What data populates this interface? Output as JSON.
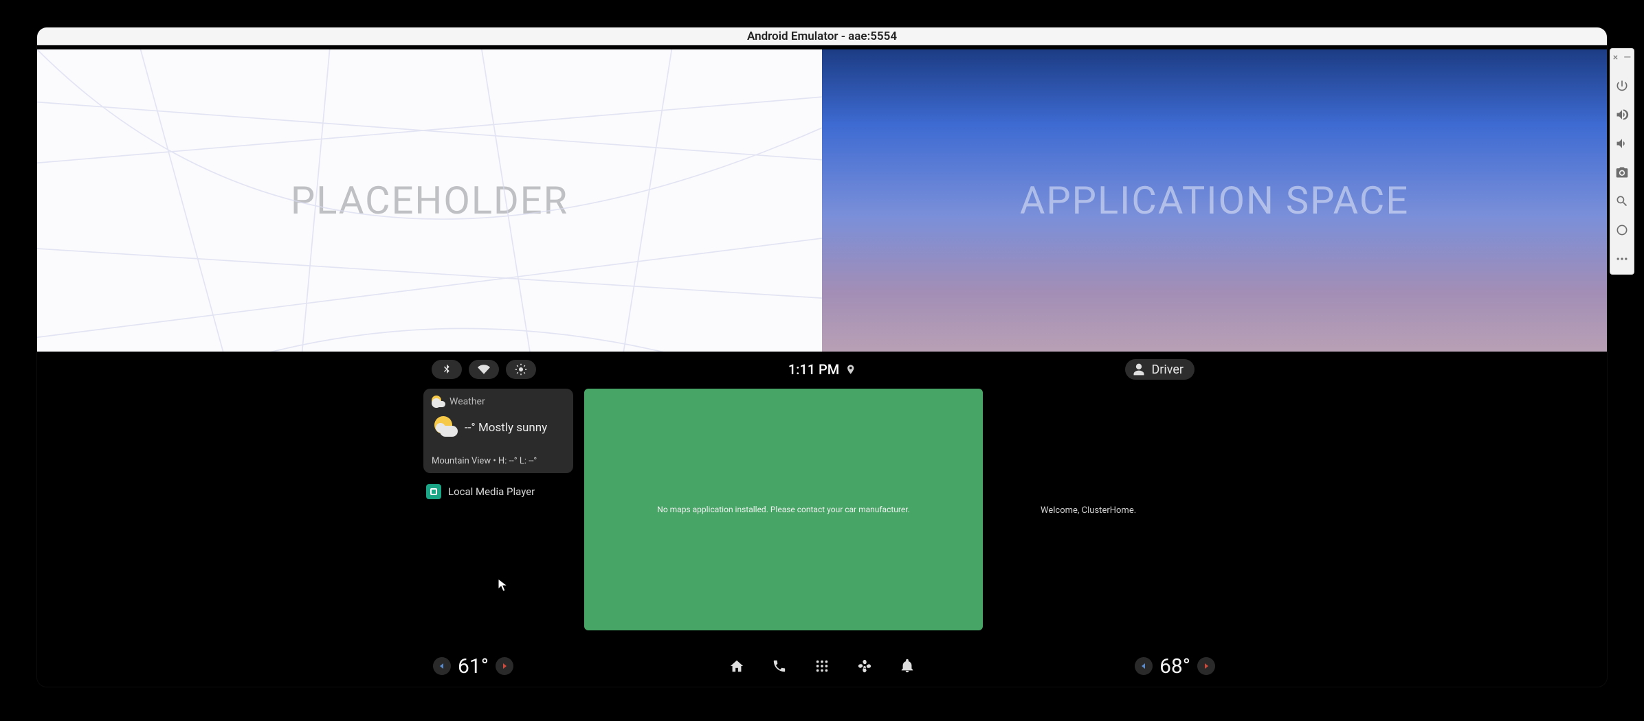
{
  "window": {
    "title": "Android Emulator - aae:5554"
  },
  "top_panels": {
    "left_label": "PLACEHOLDER",
    "right_label": "APPLICATION SPACE"
  },
  "statusbar": {
    "time": "1:11 PM",
    "user_label": "Driver"
  },
  "weather_card": {
    "title": "Weather",
    "summary": "--° Mostly sunny",
    "footer": "Mountain View • H: --° L: --°"
  },
  "media_card": {
    "title": "Local Media Player"
  },
  "map_slot": {
    "message": "No maps application installed. Please contact your car manufacturer."
  },
  "cluster": {
    "welcome": "Welcome, ClusterHome."
  },
  "hvac": {
    "left_temp": "61°",
    "right_temp": "68°"
  }
}
